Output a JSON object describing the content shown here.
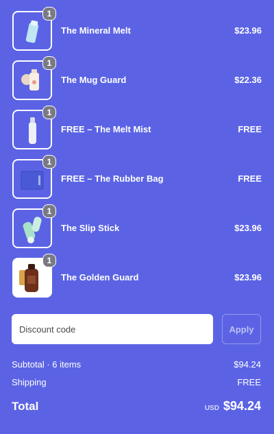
{
  "cart": {
    "items": [
      {
        "name": "The Mineral Melt",
        "price": "$23.96",
        "qty": "1",
        "icon": "tube-icon"
      },
      {
        "name": "The Mug Guard",
        "price": "$22.36",
        "qty": "1",
        "icon": "bottle-icon"
      },
      {
        "name": "FREE – The Melt Mist",
        "price": "FREE",
        "qty": "1",
        "icon": "spray-bottle-icon"
      },
      {
        "name": "FREE – The Rubber Bag",
        "price": "FREE",
        "qty": "1",
        "icon": "bag-icon"
      },
      {
        "name": "The Slip Stick",
        "price": "$23.96",
        "qty": "1",
        "icon": "stick-icon"
      },
      {
        "name": "The Golden Guard",
        "price": "$23.96",
        "qty": "1",
        "icon": "amber-bottle-icon"
      }
    ]
  },
  "discount": {
    "placeholder": "Discount code",
    "apply_label": "Apply"
  },
  "summary": {
    "subtotal_label": "Subtotal · 6 items",
    "subtotal_value": "$94.24",
    "shipping_label": "Shipping",
    "shipping_value": "FREE",
    "total_label": "Total",
    "currency": "USD",
    "total_value": "$94.24"
  },
  "colors": {
    "background": "#5b63e4",
    "text": "#ffffff",
    "badge": "#7a7a84"
  }
}
